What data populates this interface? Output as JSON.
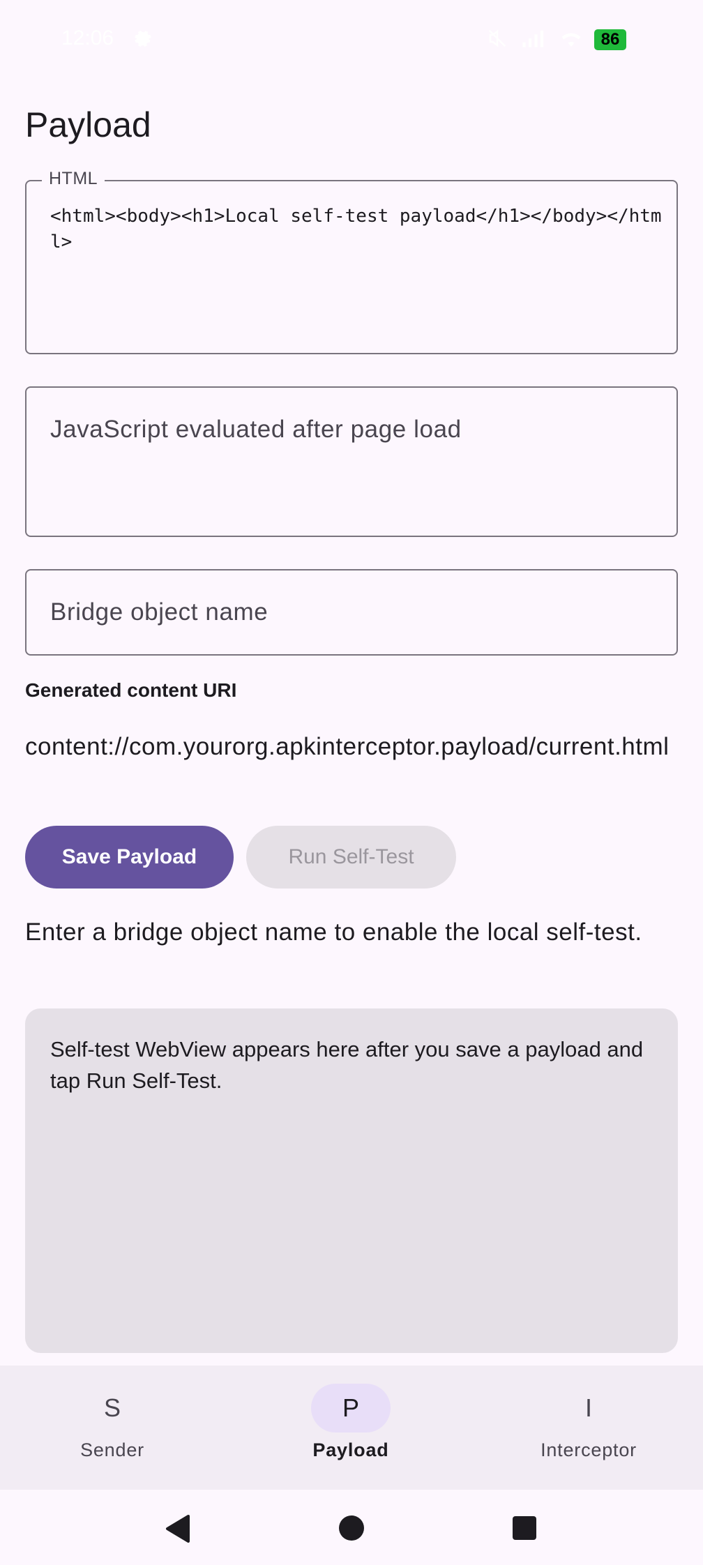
{
  "status_bar": {
    "time": "12:06",
    "battery": "86",
    "icons": [
      "gear-icon",
      "mute-icon",
      "signal-icon",
      "wifi-icon",
      "battery-icon"
    ]
  },
  "page": {
    "title": "Payload"
  },
  "html_field": {
    "label": "HTML",
    "value": "<html><body><h1>Local self-test payload</h1></body></html>"
  },
  "js_field": {
    "placeholder": "JavaScript evaluated after page load",
    "value": ""
  },
  "bridge_field": {
    "placeholder": "Bridge object name",
    "value": ""
  },
  "uri": {
    "label": "Generated content URI",
    "value": "content://com.yourorg.apkinterceptor.payload/current.html"
  },
  "buttons": {
    "save": "Save Payload",
    "run": "Run Self-Test"
  },
  "hint": "Enter a bridge object name to enable the local self-test.",
  "webview_placeholder": "Self-test WebView appears here after you save a payload and tap Run Self-Test.",
  "bottom_nav": {
    "active": "Payload",
    "items": [
      {
        "icon": "S",
        "label": "Sender"
      },
      {
        "icon": "P",
        "label": "Payload"
      },
      {
        "icon": "I",
        "label": "Interceptor"
      }
    ]
  },
  "colors": {
    "primary": "#65539f",
    "background": "#fdf7fe",
    "nav_active": "#e8def8",
    "battery": "#1fb93a"
  }
}
